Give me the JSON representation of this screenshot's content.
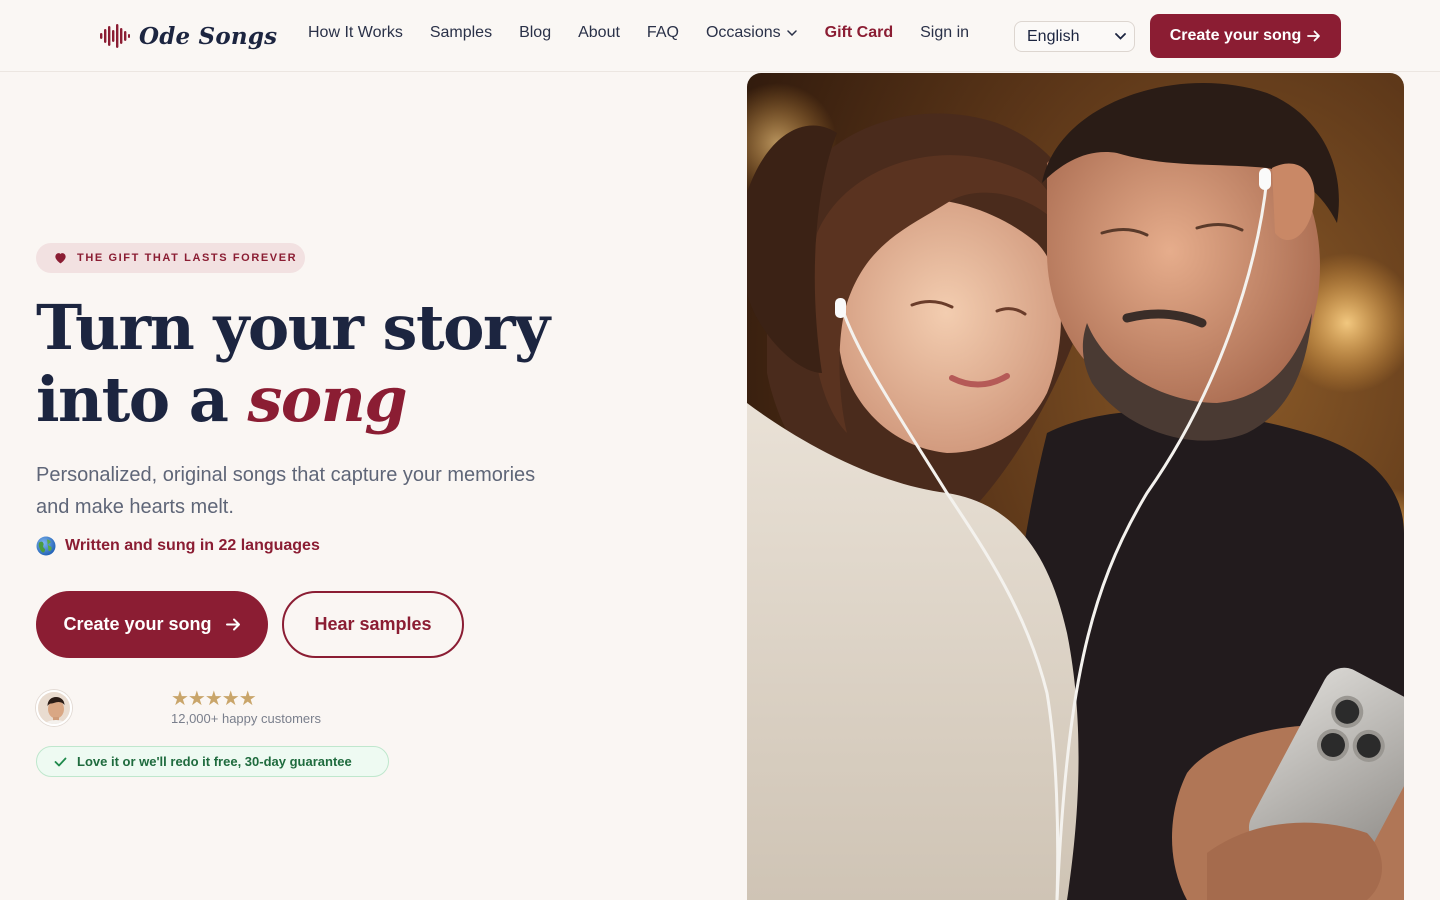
{
  "brand": {
    "name": "Ode Songs",
    "icon": "soundwave-icon"
  },
  "nav": {
    "items": [
      {
        "label": "How It Works"
      },
      {
        "label": "Samples"
      },
      {
        "label": "Blog"
      },
      {
        "label": "About"
      },
      {
        "label": "FAQ"
      },
      {
        "label": "Occasions",
        "icon": "chevron-down-icon"
      },
      {
        "label": "Gift Card"
      },
      {
        "label": "Sign in"
      }
    ]
  },
  "language_select": {
    "value": "English",
    "icon": "chevron-down-icon"
  },
  "header_cta": {
    "label": "Create your song",
    "icon": "arrow-right-icon"
  },
  "hero": {
    "badge": {
      "text": "THE GIFT THAT LASTS FOREVER",
      "icon": "heart-icon"
    },
    "headline": {
      "line1": "Turn your story",
      "line2_prefix": "into a ",
      "accent": "song"
    },
    "subtext": "Personalized, original songs that capture your memories and make hearts melt.",
    "languages_note": {
      "text": "Written and sung in 22 languages",
      "icon": "globe-icon"
    },
    "primary_button": {
      "label": "Create your song",
      "icon": "arrow-right-icon"
    },
    "secondary_button": {
      "label": "Hear samples"
    },
    "rating": {
      "stars": "★★★★★",
      "value": 5,
      "customers": "12,000+ happy customers"
    },
    "guarantee": {
      "text": "Love it or we'll redo it free, 30-day guarantee",
      "icon": "check-icon"
    }
  },
  "colors": {
    "brand": "#8b1d33",
    "navy": "#1c2540",
    "background": "#faf6f3",
    "gold": "#c9a56a",
    "success": "#1f6b3e"
  }
}
